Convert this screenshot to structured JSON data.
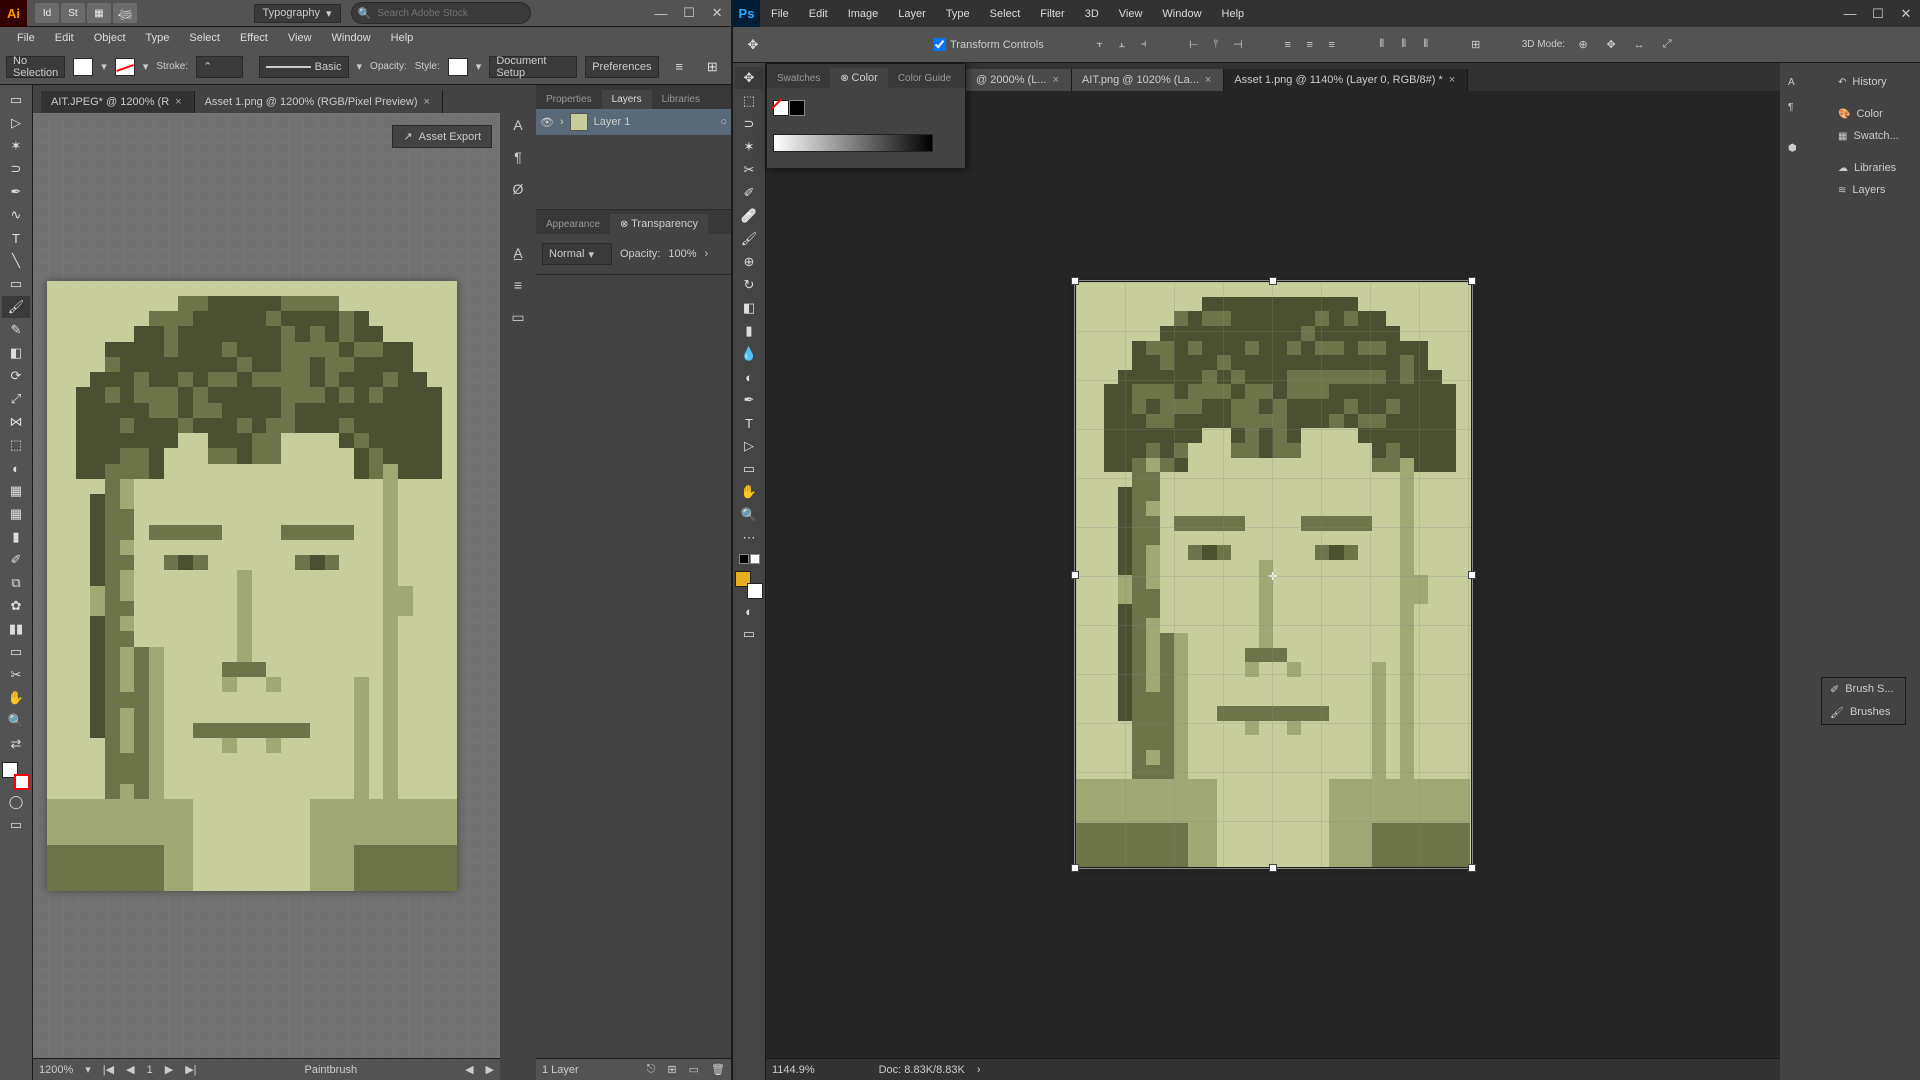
{
  "ai": {
    "menus": [
      "File",
      "Edit",
      "Object",
      "Type",
      "Select",
      "Effect",
      "View",
      "Window",
      "Help"
    ],
    "workspace": "Typography",
    "search_placeholder": "Search Adobe Stock",
    "options": {
      "no_selection": "No Selection",
      "stroke_label": "Stroke:",
      "stroke_style": "Basic",
      "opacity_label": "Opacity:",
      "style_label": "Style:",
      "doc_setup": "Document Setup",
      "prefs": "Preferences"
    },
    "tabs": [
      {
        "label": "AIT.JPEG* @ 1200% (R"
      },
      {
        "label": "Asset 1.png @ 1200% (RGB/Pixel Preview)"
      }
    ],
    "asset_export": "Asset Export",
    "panels": {
      "properties": "Properties",
      "layers": "Layers",
      "libraries": "Libraries",
      "layer_name": "Layer 1",
      "appearance": "Appearance",
      "transparency": "Transparency",
      "blend": "Normal",
      "opacity_label": "Opacity:",
      "opacity_val": "100%",
      "layer_count": "1 Layer"
    },
    "status": {
      "zoom": "1200%",
      "page": "1",
      "tool": "Paintbrush"
    }
  },
  "ps": {
    "menus": [
      "File",
      "Edit",
      "Image",
      "Layer",
      "Type",
      "Select",
      "Filter",
      "3D",
      "View",
      "Window",
      "Help"
    ],
    "options": {
      "transform_controls": "Transform Controls",
      "mode_3d": "3D Mode:"
    },
    "tabs_overflow": [
      {
        "label": "@ 2000% (L..."
      },
      {
        "label": "AIT.png @ 1020% (La..."
      },
      {
        "label": "Asset 1.png @ 1140% (Layer 0, RGB/8#) *",
        "active": true
      }
    ],
    "panel_tabs": {
      "swatches": "Swatches",
      "color": "Color",
      "color_guide": "Color Guide"
    },
    "right_panels": [
      "History",
      "Color",
      "Swatch...",
      "Libraries",
      "Layers"
    ],
    "brush_float": [
      "Brush S...",
      "Brushes"
    ],
    "status": {
      "zoom": "1144.9%",
      "doc": "Doc: 8.83K/8.83K"
    }
  }
}
